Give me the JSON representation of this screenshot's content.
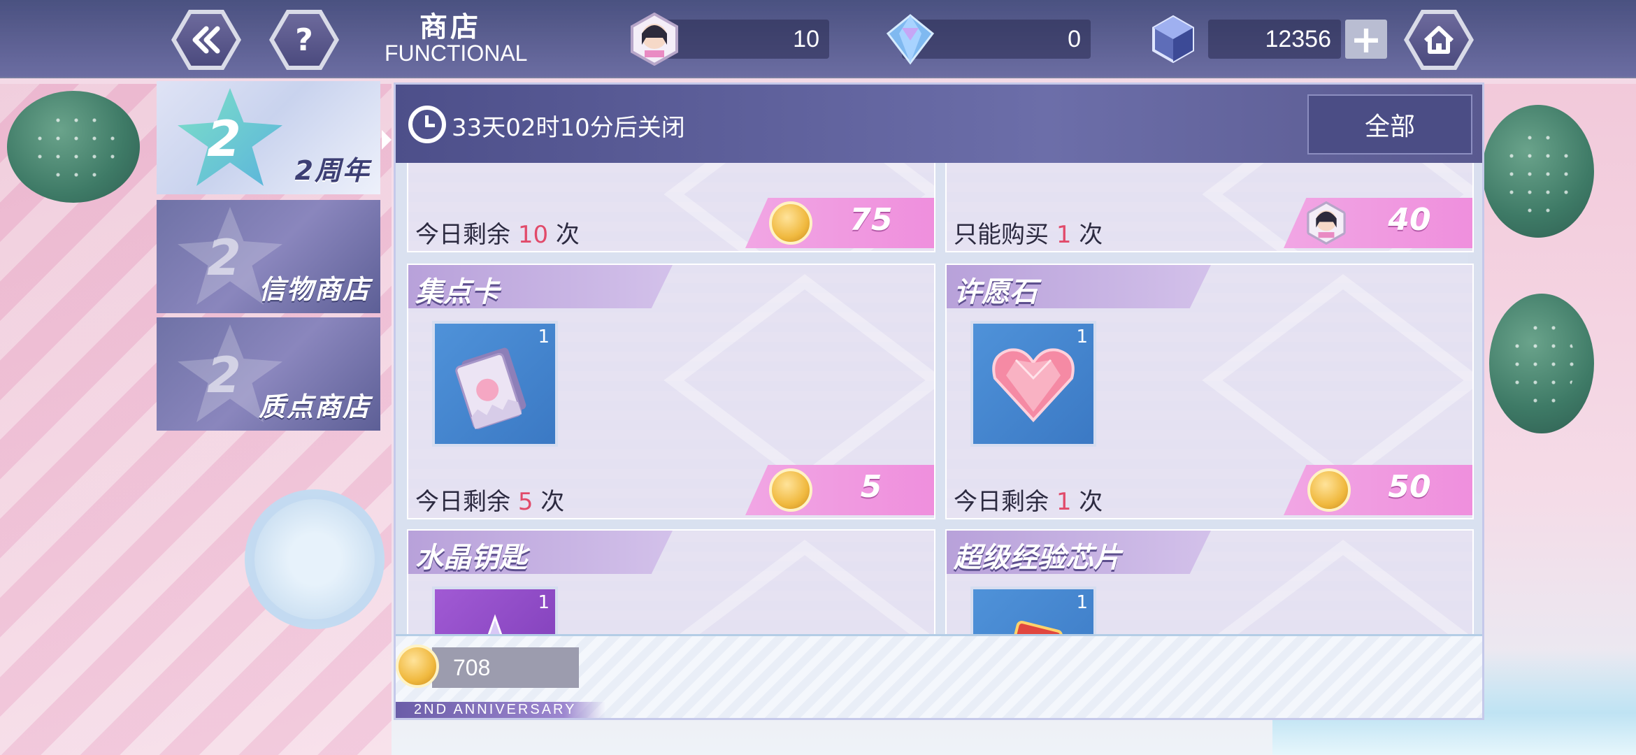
{
  "header": {
    "title": "商店",
    "subtitle": "FUNCTIONAL",
    "back_icon": "back-arrow-icon",
    "help_icon": "question-icon",
    "home_icon": "home-icon"
  },
  "currencies": [
    {
      "name": "portrait-token",
      "value": "10"
    },
    {
      "name": "crystal",
      "value": "0"
    },
    {
      "name": "cube",
      "value": "12356"
    }
  ],
  "sidebar": {
    "tabs": [
      {
        "label": "2周年",
        "active": true
      },
      {
        "label": "信物商店",
        "active": false
      },
      {
        "label": "质点商店",
        "active": false
      }
    ]
  },
  "panel": {
    "timer": "33天02时10分后关闭",
    "filter": "全部",
    "items": [
      {
        "name": "",
        "remain_prefix": "今日剩余",
        "remain_num": "10",
        "remain_suffix": "次",
        "price": "75",
        "price_currency": "coin"
      },
      {
        "name": "",
        "remain_prefix": "只能购买",
        "remain_num": "1",
        "remain_suffix": "次",
        "price": "40",
        "price_currency": "portrait-token"
      },
      {
        "name": "集点卡",
        "qty": "1",
        "remain_prefix": "今日剩余",
        "remain_num": "5",
        "remain_suffix": "次",
        "price": "5",
        "price_currency": "coin"
      },
      {
        "name": "许愿石",
        "qty": "1",
        "remain_prefix": "今日剩余",
        "remain_num": "1",
        "remain_suffix": "次",
        "price": "50",
        "price_currency": "coin"
      },
      {
        "name": "水晶钥匙",
        "qty": "1"
      },
      {
        "name": "超级经验芯片",
        "qty": "1"
      }
    ],
    "balance": "708",
    "anniversary": "2ND ANNIVERSARY"
  },
  "colors": {
    "header_bg": "#4d4f8a",
    "price_pink": "#ef8fdd",
    "remain_accent": "#e14a6a"
  }
}
